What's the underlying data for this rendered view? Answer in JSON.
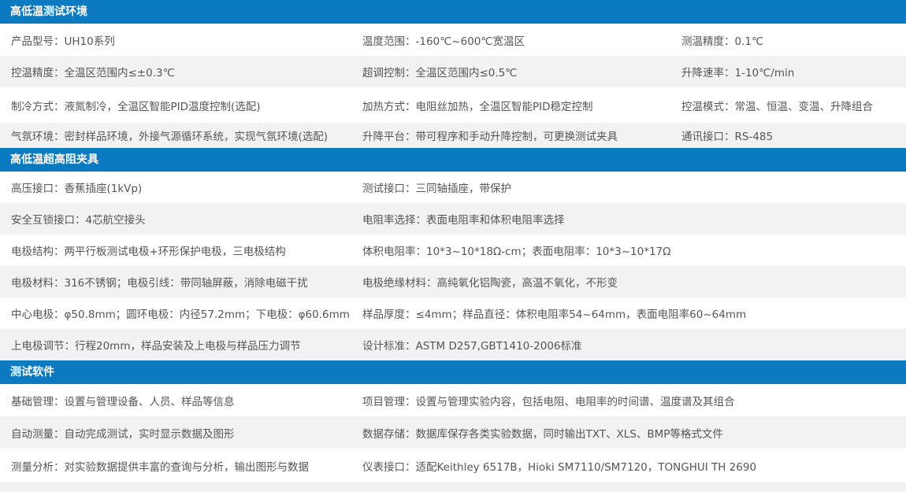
{
  "sections": [
    {
      "title": "高低温测试环境",
      "rows": [
        [
          "产品型号：UH10系列",
          "温度范围：-160℃~600℃宽温区",
          "测温精度：0.1℃"
        ],
        [
          "控温精度：全温区范围内≤±0.3℃",
          "超调控制：全温区范围内≤0.5℃",
          "升降速率：1-10℃/min"
        ],
        [
          "制冷方式：液氮制冷，全温区智能PID温度控制(选配)",
          "加热方式：电阻丝加热，全温区智能PID稳定控制",
          "控温模式：常温、恒温、变温、升降组合"
        ],
        [
          "气氛环境：密封样品环境，外接气源循环系统，实现气氛环境(选配)",
          "升降平台：带可程序和手动升降控制，可更换测试夹具",
          "通讯接口：RS-485"
        ]
      ]
    },
    {
      "title": "高低温超高阻夹具",
      "rows": [
        [
          "高压接口：香蕉插座(1kVp)",
          "测试接口：三同轴插座，带保护"
        ],
        [
          "安全互锁接口：4芯航空接头",
          "电阻率选择：表面电阻率和体积电阻率选择"
        ],
        [
          "电极结构：两平行板测试电极+环形保护电极，三电极结构",
          "体积电阻率：10*3~10*18Ω-cm；表面电阻率：10*3~10*17Ω"
        ],
        [
          "电极材料：316不锈钢；电极引线：带同轴屏蔽，消除电磁干扰",
          "电极绝缘材料：高纯氧化铝陶瓷，高温不氧化，不形变"
        ],
        [
          "中心电极：φ50.8mm；圆环电极：内径57.2mm；下电极：φ60.6mm",
          "样品厚度：≤4mm；样品直径：体积电阻率54~64mm，表面电阻率60~64mm"
        ],
        [
          "上电极调节：行程20mm，样品安装及上电极与样品压力调节",
          "设计标准：ASTM D257,GBT1410-2006标准"
        ]
      ]
    },
    {
      "title": "测试软件",
      "rows": [
        [
          "基础管理：设置与管理设备、人员、样品等信息",
          "项目管理：设置与管理实验内容，包括电阻、电阻率的时间谱、温度谱及其组合"
        ],
        [
          "自动测量：自动完成测试，实时显示数据及图形",
          "数据存储：数据库保存各类实验数据，同时输出TXT、XLS、BMP等格式文件"
        ],
        [
          "测量分析：对实验数据提供丰富的查询与分析，输出图形与数据",
          "仪表接口：适配Keithley 6517B，Hioki SM7110/SM7120，TONGHUI TH 2690"
        ]
      ]
    }
  ]
}
